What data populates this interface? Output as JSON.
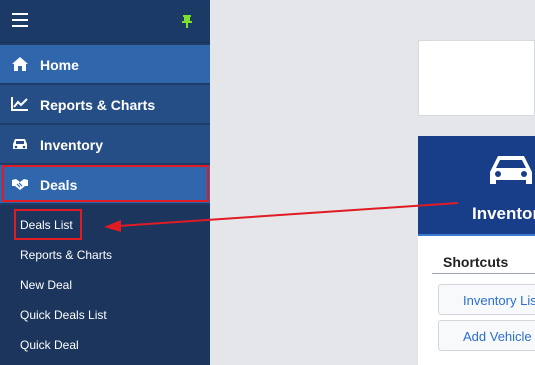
{
  "sidebar": {
    "nav": [
      {
        "label": "Home",
        "icon": "home-icon"
      },
      {
        "label": "Reports & Charts",
        "icon": "chart-line-icon"
      },
      {
        "label": "Inventory",
        "icon": "car-icon"
      },
      {
        "label": "Deals",
        "icon": "handshake-icon"
      }
    ],
    "deals_submenu": [
      "Deals List",
      "Reports & Charts",
      "New Deal",
      "Quick Deals List",
      "Quick Deal"
    ]
  },
  "panel": {
    "title": "Inventory",
    "shortcuts_title": "Shortcuts",
    "shortcuts": [
      "Inventory List",
      "Add Vehicle"
    ]
  },
  "colors": {
    "sidebar_bg": "#1f3d66",
    "nav_active": "#3067ac",
    "highlight": "#e01b24",
    "panel_header": "#183e8a",
    "link": "#2a6fd0",
    "pin": "#7ee02a"
  }
}
